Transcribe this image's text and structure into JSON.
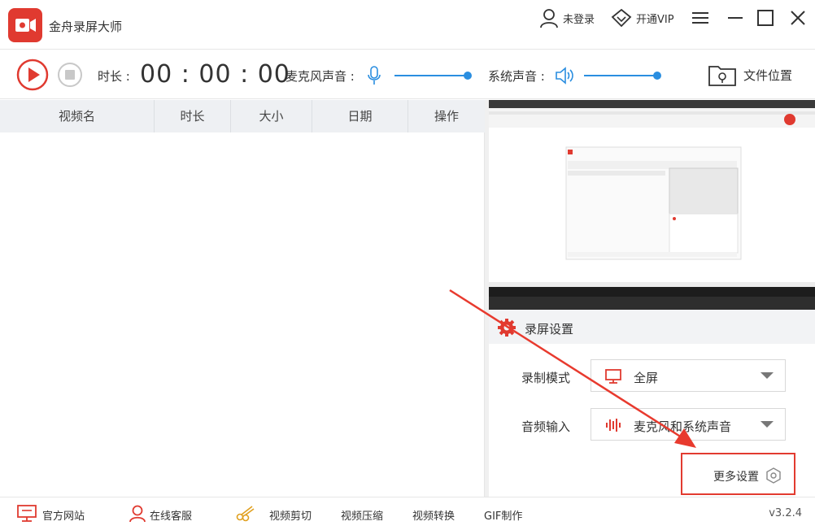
{
  "app": {
    "title": "金舟录屏大师",
    "accent": "#e03a30"
  },
  "header": {
    "login_label": "未登录",
    "vip_label": "开通VIP"
  },
  "toolbar": {
    "duration_label": "时长 :",
    "timer": "00 : 00 : 00",
    "mic_label": "麦克风声音 :",
    "system_label": "系统声音 :",
    "mic_volume_fraction": 1.0,
    "system_volume_fraction": 1.0,
    "file_location_label": "文件位置"
  },
  "list": {
    "columns": [
      "视频名",
      "时长",
      "大小",
      "日期",
      "操作"
    ]
  },
  "settings": {
    "title": "录屏设置",
    "mode_label": "录制模式",
    "mode_value": "全屏",
    "audio_label": "音频输入",
    "audio_value": "麦克风和系统声音",
    "more_label": "更多设置"
  },
  "footer": {
    "website": "官方网站",
    "support": "在线客服",
    "video_cut": "视频剪切",
    "video_compress": "视频压缩",
    "video_convert": "视频转换",
    "gif": "GIF制作",
    "version": "v3.2.4"
  },
  "icons": {
    "logo": "record-camera-icon",
    "user": "user-icon",
    "vip": "diamond-icon",
    "menu": "hamburger-icon",
    "minimize": "minimize-icon",
    "maximize": "maximize-icon",
    "close": "close-icon",
    "record": "record-play-icon",
    "stop": "stop-icon",
    "mic": "microphone-icon",
    "speaker": "speaker-icon",
    "folder": "folder-location-icon",
    "gear": "gear-icon",
    "monitor": "monitor-icon",
    "audio_wave": "audio-wave-icon",
    "hexagon": "hexagon-icon"
  }
}
